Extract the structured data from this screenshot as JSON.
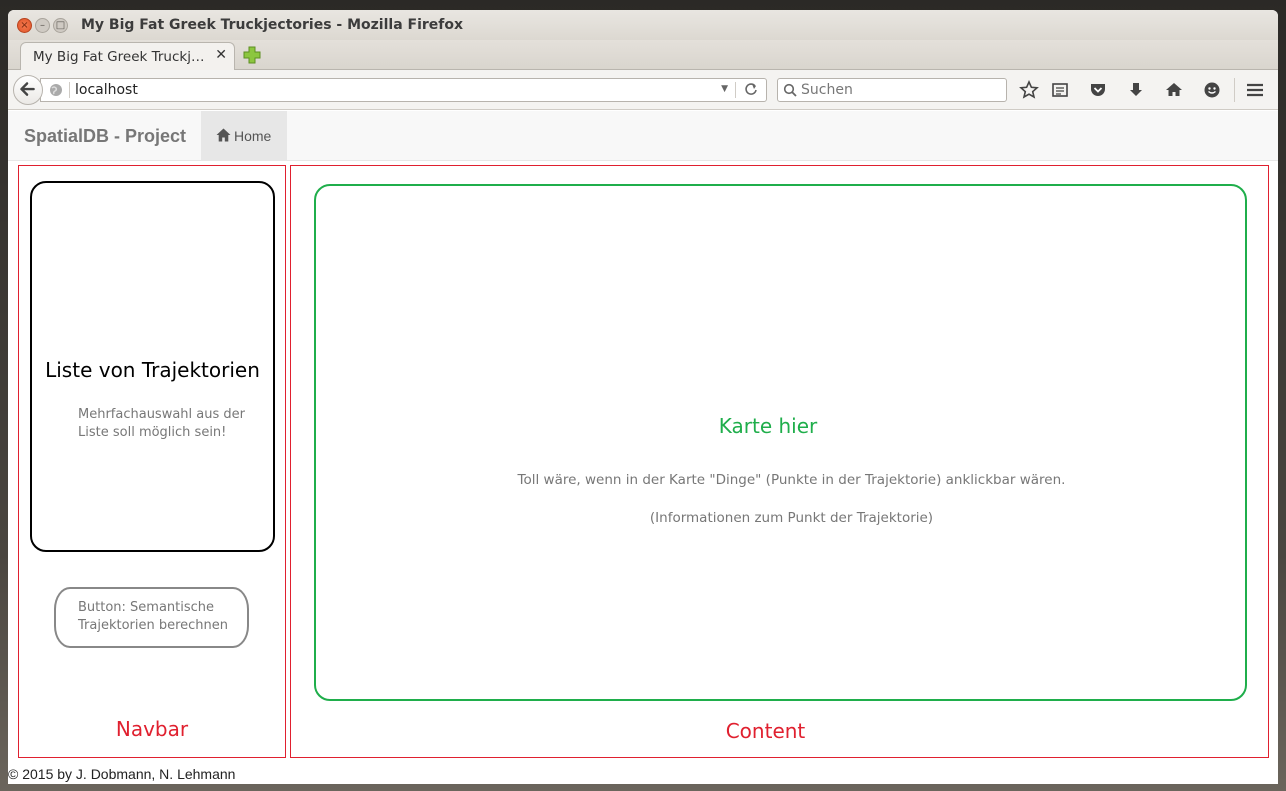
{
  "window": {
    "title": "My Big Fat Greek Truckjectories - Mozilla Firefox",
    "close_glyph": "×",
    "min_glyph": "–",
    "max_glyph": "□"
  },
  "tabs": [
    {
      "label": "My Big Fat Greek Truckj…",
      "close_glyph": "✕",
      "active": true
    }
  ],
  "toolbar": {
    "url": "localhost",
    "search_placeholder": "Suchen",
    "icons": [
      "back-icon",
      "globe-icon",
      "dropdown-icon",
      "reload-icon",
      "search-icon",
      "bookmark-star-icon",
      "reading-list-icon",
      "pocket-icon",
      "download-icon",
      "home-icon",
      "hello-icon",
      "menu-icon"
    ]
  },
  "site": {
    "brand": "SpatialDB - Project",
    "nav": [
      {
        "label": "Home",
        "icon": "home-icon",
        "active": true
      }
    ]
  },
  "sidebar": {
    "list_title": "Liste von Trajektorien",
    "list_note": "Mehrfachauswahl aus der Liste soll möglich sein!",
    "button_note": "Button: Semantische Trajektorien berechnen",
    "caption": "Navbar"
  },
  "main": {
    "map_title": "Karte hier",
    "map_note_1": "Toll wäre, wenn in der Karte \"Dinge\" (Punkte in der Trajektorie) anklickbar wären.",
    "map_note_2": "(Informationen zum Punkt der Trajektorie)",
    "caption": "Content"
  },
  "footer": {
    "text": "© 2015 by J. Dobmann, N. Lehmann"
  },
  "colors": {
    "annotation_red": "#e0202f",
    "map_green": "#1fae4b",
    "list_border": "#000000",
    "button_border": "#888888"
  }
}
